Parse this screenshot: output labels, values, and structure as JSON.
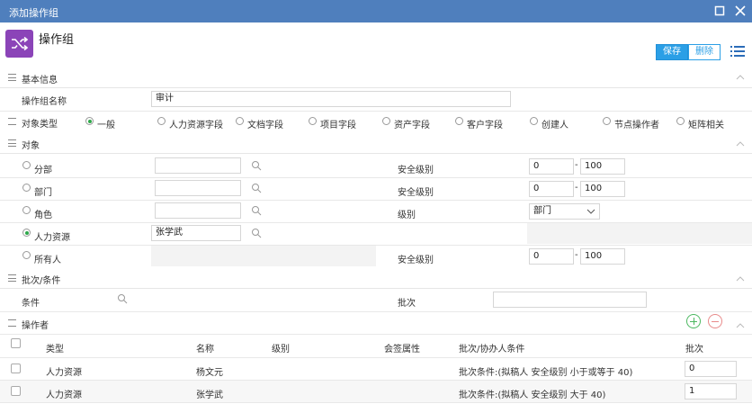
{
  "window": {
    "title": "添加操作组"
  },
  "header": {
    "title": "操作组",
    "save_label": "保存",
    "delete_label": "删除"
  },
  "basic": {
    "section_label": "基本信息",
    "name_label": "操作组名称",
    "name_value": "审计",
    "type_label": "对象类型",
    "type_options": [
      "一般",
      "人力资源字段",
      "文档字段",
      "项目字段",
      "资产字段",
      "客户字段",
      "创建人",
      "节点操作者",
      "矩阵相关"
    ],
    "type_selected": "一般"
  },
  "object": {
    "section_label": "对象",
    "rows": [
      {
        "label": "分部",
        "value": "",
        "right_label": "安全级别",
        "range_from": "0",
        "range_to": "100"
      },
      {
        "label": "部门",
        "value": "",
        "right_label": "安全级别",
        "range_from": "0",
        "range_to": "100"
      },
      {
        "label": "角色",
        "value": "",
        "right_label": "级别",
        "select_value": "部门"
      },
      {
        "label": "人力资源",
        "value": "张学武",
        "right_label": "",
        "selected": true
      },
      {
        "label": "所有人",
        "right_label": "安全级别",
        "range_from": "0",
        "range_to": "100"
      }
    ],
    "range_sep": "-"
  },
  "batch": {
    "section_label": "批次/条件",
    "condition_label": "条件",
    "batch_label": "批次",
    "batch_value": ""
  },
  "operators": {
    "section_label": "操作者",
    "columns": [
      "类型",
      "名称",
      "级别",
      "会签属性",
      "批次/协办人条件",
      "批次"
    ],
    "rows": [
      {
        "type": "人力资源",
        "name": "杨文元",
        "level": "",
        "countersign": "",
        "condition": "批次条件:(拟稿人 安全级别 小于或等于 40)",
        "batch": "0"
      },
      {
        "type": "人力资源",
        "name": "张学武",
        "level": "",
        "countersign": "",
        "condition": "批次条件:(拟稿人 安全级别 大于 40)",
        "batch": "1"
      }
    ]
  },
  "colors": {
    "titlebar": "#4f7fbd",
    "accent": "#2b9fe6",
    "app_icon": "#8b44b8",
    "radio_on": "#2ea84a"
  }
}
